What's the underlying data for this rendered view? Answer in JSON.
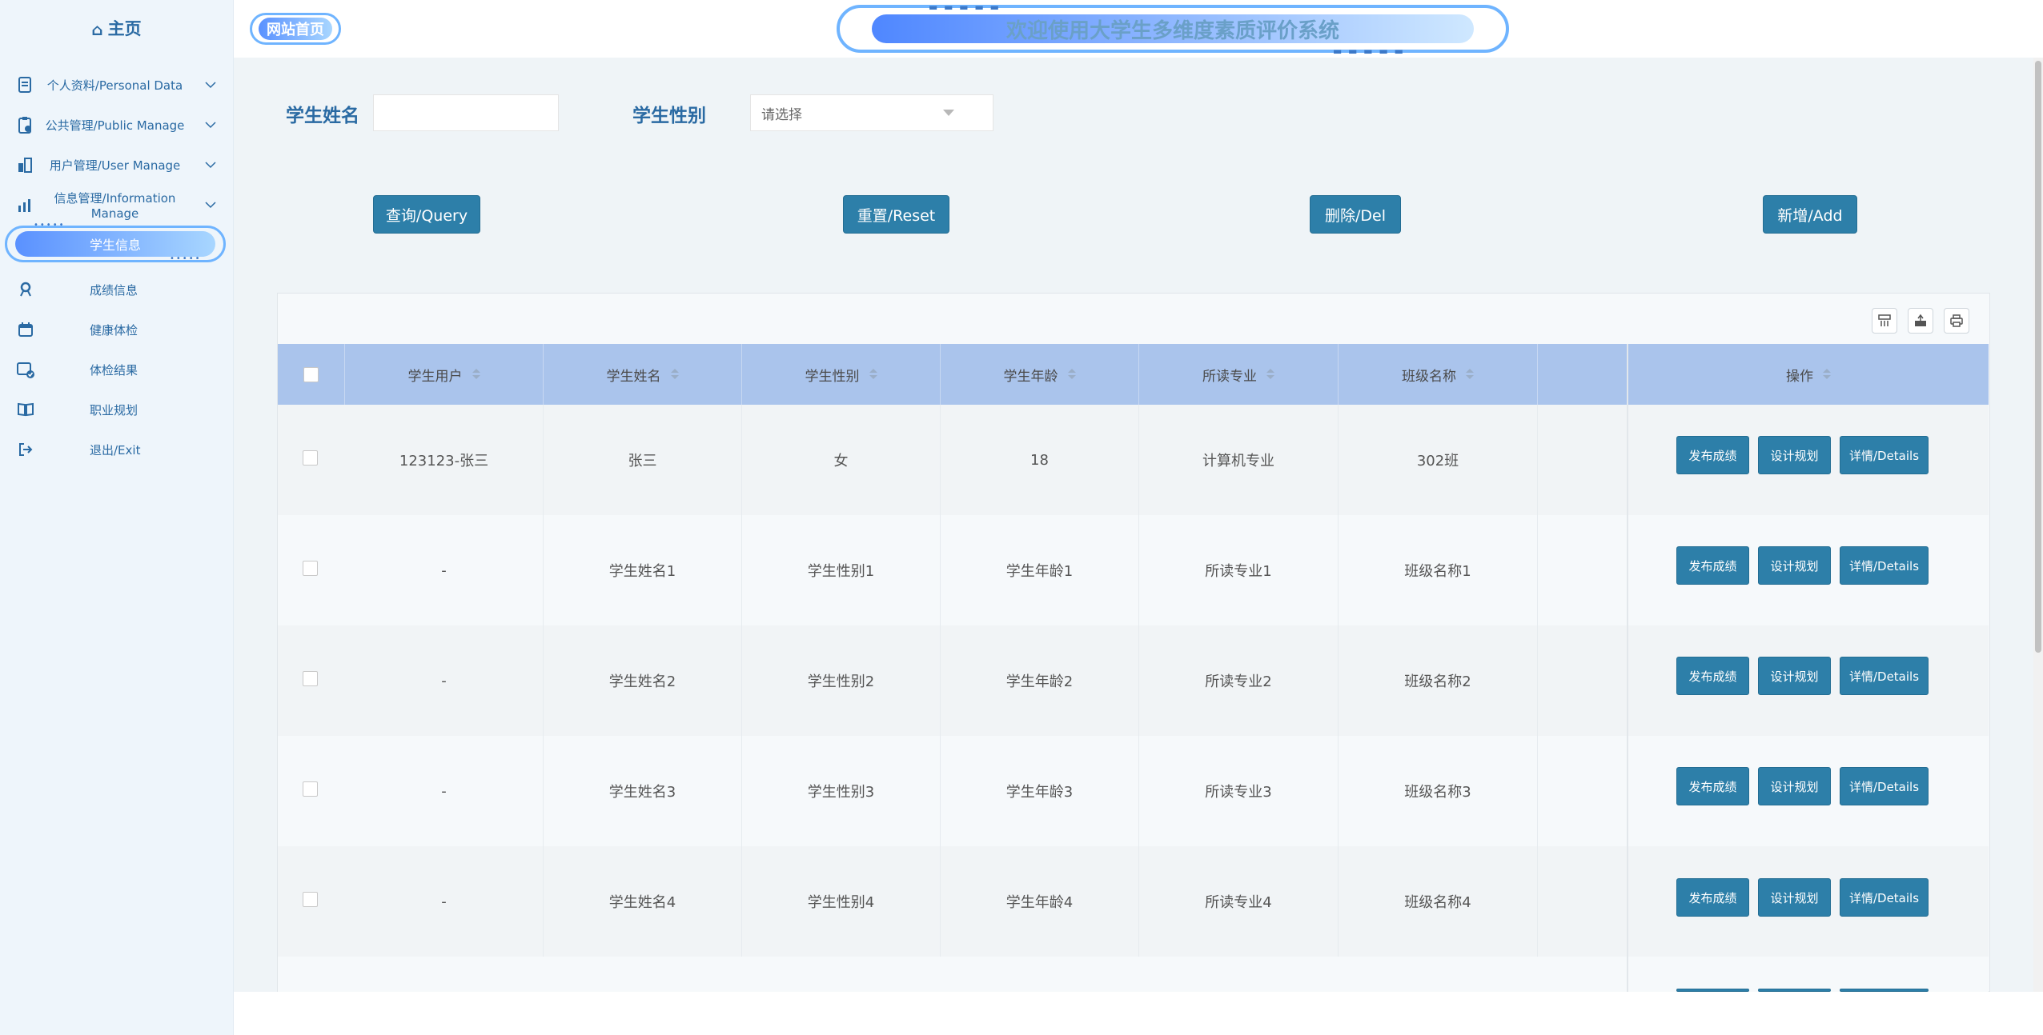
{
  "sidebar": {
    "home": "主页",
    "menus": [
      {
        "label": "个人资料/Personal Data"
      },
      {
        "label": "公共管理/Public Manage"
      },
      {
        "label": "用户管理/User Manage"
      },
      {
        "label": "信息管理/Information Manage"
      }
    ],
    "active": "学生信息",
    "subs": [
      {
        "label": "成绩信息"
      },
      {
        "label": "健康体检"
      },
      {
        "label": "体检结果"
      },
      {
        "label": "职业规划"
      },
      {
        "label": "退出/Exit"
      }
    ]
  },
  "header": {
    "home_button": "网站首页",
    "title": "欢迎使用大学生多维度素质评价系统"
  },
  "search": {
    "name_label": "学生姓名",
    "gender_label": "学生性别",
    "gender_placeholder": "请选择"
  },
  "actions": {
    "query": "查询/Query",
    "reset": "重置/Reset",
    "delete": "删除/Del",
    "add": "新增/Add"
  },
  "table": {
    "columns": [
      "学生用户",
      "学生姓名",
      "学生性别",
      "学生年龄",
      "所读专业",
      "班级名称",
      "",
      "操作"
    ],
    "rows": [
      {
        "user": "123123-张三",
        "name": "张三",
        "gender": "女",
        "age": "18",
        "major": "计算机专业",
        "class": "302班"
      },
      {
        "user": "-",
        "name": "学生姓名1",
        "gender": "学生性别1",
        "age": "学生年龄1",
        "major": "所读专业1",
        "class": "班级名称1"
      },
      {
        "user": "-",
        "name": "学生姓名2",
        "gender": "学生性别2",
        "age": "学生年龄2",
        "major": "所读专业2",
        "class": "班级名称2"
      },
      {
        "user": "-",
        "name": "学生姓名3",
        "gender": "学生性别3",
        "age": "学生年龄3",
        "major": "所读专业3",
        "class": "班级名称3"
      },
      {
        "user": "-",
        "name": "学生姓名4",
        "gender": "学生性别4",
        "age": "学生年龄4",
        "major": "所读专业4",
        "class": "班级名称4"
      }
    ],
    "row_buttons": {
      "publish": "发布成绩",
      "plan": "设计规划",
      "details": "详情/Details"
    }
  },
  "colors": {
    "accent": "#2d7fa9",
    "header_row": "#aac4ec",
    "sidebar_text": "#2a6aa3"
  }
}
